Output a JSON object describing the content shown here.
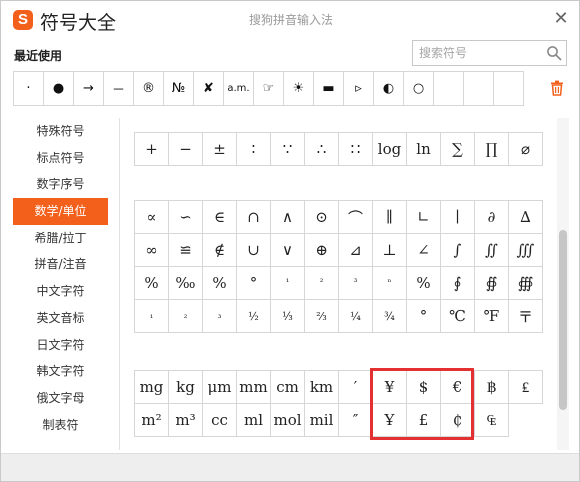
{
  "app": {
    "title": "符号大全",
    "subtitle": "搜狗拼音输入法",
    "logo_letter": "S",
    "close_glyph": "✕",
    "brand_color": "#f2601b"
  },
  "recent": {
    "label": "最近使用",
    "symbols": [
      "·",
      "●",
      "→",
      "－",
      "®",
      "№",
      "✘",
      "a.m.",
      "☞",
      "☀",
      "▬",
      "▹",
      "◐",
      "○",
      "",
      "",
      ""
    ]
  },
  "search": {
    "placeholder": "搜索符号"
  },
  "sidebar": {
    "items": [
      {
        "label": "特殊符号"
      },
      {
        "label": "标点符号"
      },
      {
        "label": "数字序号"
      },
      {
        "label": "数学/单位",
        "active": true
      },
      {
        "label": "希腊/拉丁"
      },
      {
        "label": "拼音/注音"
      },
      {
        "label": "中文字符"
      },
      {
        "label": "英文音标"
      },
      {
        "label": "日文字符"
      },
      {
        "label": "韩文字符"
      },
      {
        "label": "俄文字母"
      },
      {
        "label": "制表符"
      }
    ]
  },
  "math_top_row": [
    "+",
    "−",
    "±",
    "∶",
    "∵",
    "∴",
    "∷",
    "log",
    "ln",
    "∑",
    "∏",
    "⌀"
  ],
  "math_rows": [
    [
      "∝",
      "∽",
      "∈",
      "∩",
      "∧",
      "⊙",
      "⌒",
      "∥",
      "∟",
      "∣",
      "∂",
      "∆"
    ],
    [
      "∞",
      "≌",
      "∉",
      "∪",
      "∨",
      "⊕",
      "⊿",
      "⊥",
      "∠",
      "∫",
      "∬",
      "∭"
    ],
    [
      "%",
      "‰",
      "%",
      "°",
      "¹",
      "²",
      "³",
      "ⁿ",
      "%",
      "∮",
      "∯",
      "∰"
    ],
    [
      "₁",
      "₂",
      "₃",
      "½",
      "⅓",
      "⅔",
      "¼",
      "¾",
      "°",
      "℃",
      "℉",
      "〒"
    ]
  ],
  "unit_rows": [
    [
      "mg",
      "kg",
      "μm",
      "mm",
      "cm",
      "km",
      "′",
      "¥",
      "$",
      "€",
      "฿",
      "₤"
    ],
    [
      "m²",
      "m³",
      "cc",
      "ml",
      "mol",
      "mil",
      "″",
      "Ұ",
      "£",
      "₵",
      "₠",
      ""
    ]
  ],
  "accent_color": "#e33131"
}
